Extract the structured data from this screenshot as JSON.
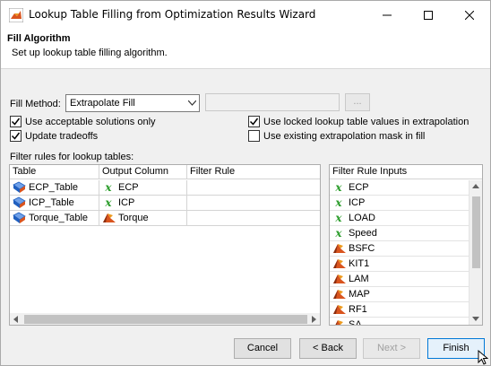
{
  "window": {
    "title": "Lookup Table Filling from Optimization Results Wizard"
  },
  "header": {
    "title": "Fill Algorithm",
    "subtitle": "Set up lookup table filling algorithm."
  },
  "fill_method": {
    "label": "Fill Method:",
    "selected": "Extrapolate Fill",
    "extra_button": "..."
  },
  "options": {
    "use_acceptable": {
      "label": "Use acceptable solutions only",
      "checked": true
    },
    "update_tradeoffs": {
      "label": "Update tradeoffs",
      "checked": true
    },
    "use_locked": {
      "label": "Use locked lookup table values in extrapolation",
      "checked": true
    },
    "use_existing_mask": {
      "label": "Use existing extrapolation mask in fill",
      "checked": false
    }
  },
  "filter_rules": {
    "label": "Filter rules for lookup tables:",
    "columns": [
      "Table",
      "Output Column",
      "Filter Rule"
    ],
    "rows": [
      {
        "table": "ECP_Table",
        "output": "ECP",
        "output_icon": "variable-x-icon",
        "rule": ""
      },
      {
        "table": "ICP_Table",
        "output": "ICP",
        "output_icon": "variable-x-icon",
        "rule": ""
      },
      {
        "table": "Torque_Table",
        "output": "Torque",
        "output_icon": "model-surface-icon",
        "rule": ""
      }
    ]
  },
  "filter_inputs": {
    "header": "Filter Rule Inputs",
    "items": [
      {
        "label": "ECP",
        "icon": "variable-x-icon"
      },
      {
        "label": "ICP",
        "icon": "variable-x-icon"
      },
      {
        "label": "LOAD",
        "icon": "variable-x-icon"
      },
      {
        "label": "Speed",
        "icon": "variable-x-icon"
      },
      {
        "label": "BSFC",
        "icon": "model-surface-icon"
      },
      {
        "label": "KIT1",
        "icon": "model-surface-icon"
      },
      {
        "label": "LAM",
        "icon": "model-surface-icon"
      },
      {
        "label": "MAP",
        "icon": "model-surface-icon"
      },
      {
        "label": "RF1",
        "icon": "model-surface-icon"
      },
      {
        "label": "SA",
        "icon": "model-surface-icon"
      }
    ]
  },
  "buttons": {
    "cancel": "Cancel",
    "back": "< Back",
    "next": "Next >",
    "finish": "Finish"
  },
  "colors": {
    "accent": "#0078d7",
    "variable_green": "#2e9e2e",
    "table_icon_blue": "#1f5fbf"
  }
}
